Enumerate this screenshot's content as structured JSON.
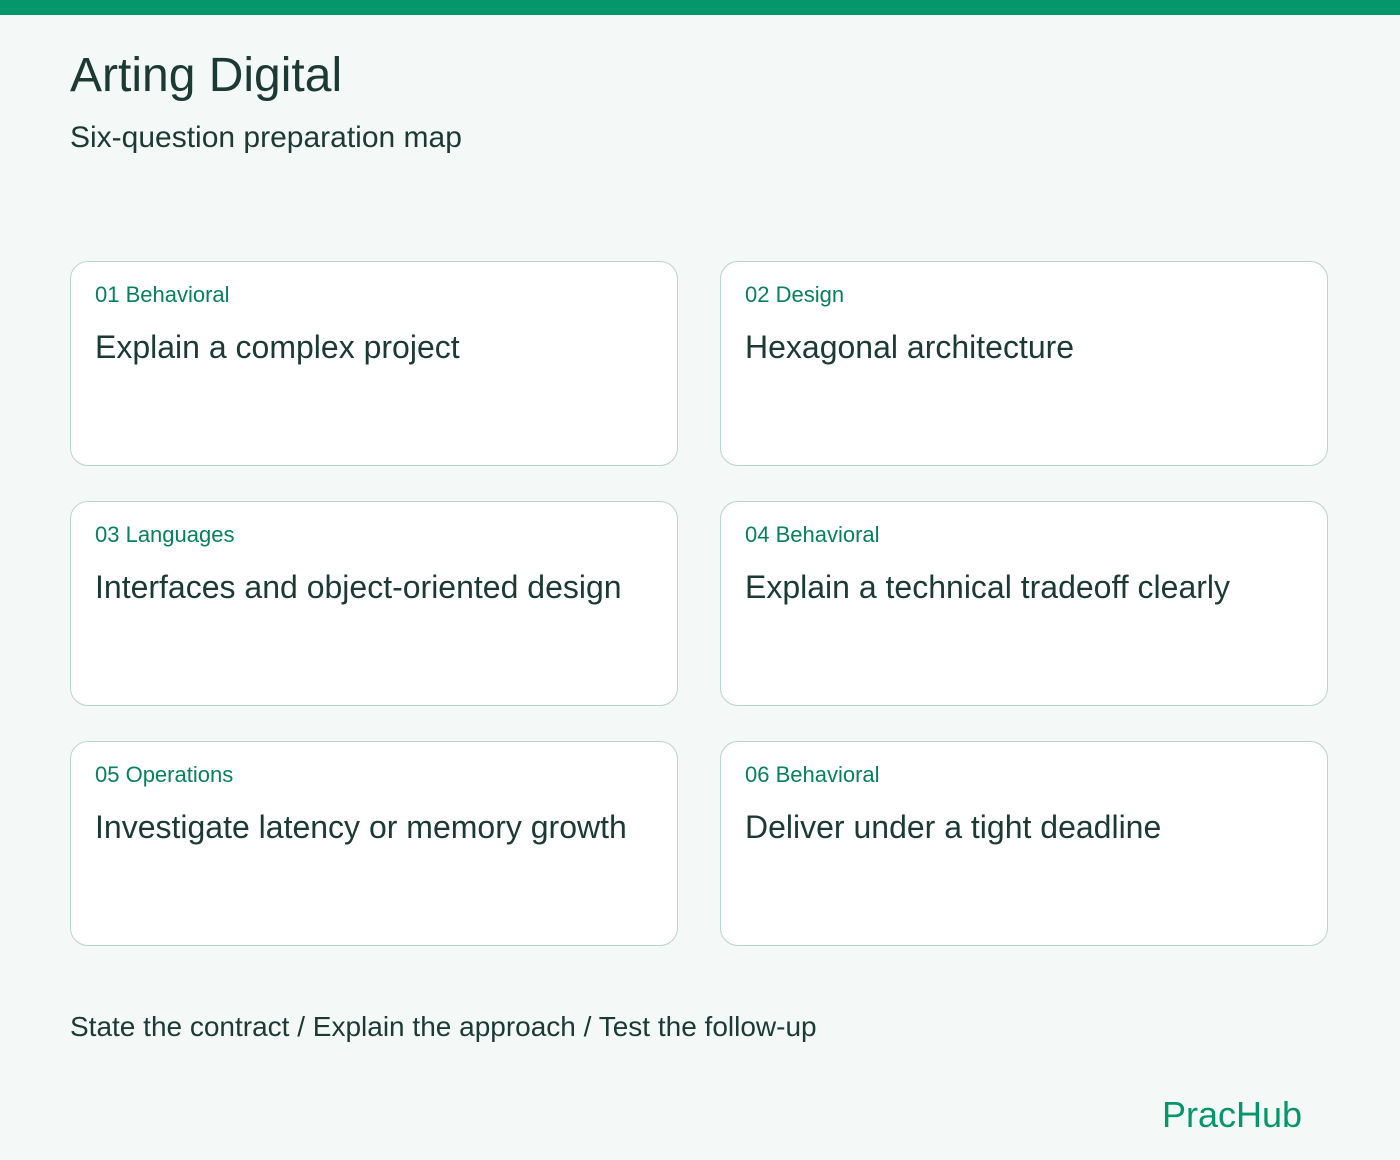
{
  "header": {
    "title": "Arting Digital",
    "subtitle": "Six-question preparation map"
  },
  "cards": [
    {
      "tag": "01 Behavioral",
      "title": "Explain a complex project"
    },
    {
      "tag": "02 Design",
      "title": "Hexagonal architecture"
    },
    {
      "tag": "03 Languages",
      "title": "Interfaces and object-oriented design"
    },
    {
      "tag": "04 Behavioral",
      "title": "Explain a technical tradeoff clearly"
    },
    {
      "tag": "05 Operations",
      "title": "Investigate latency or memory growth"
    },
    {
      "tag": "06 Behavioral",
      "title": "Deliver under a tight deadline"
    }
  ],
  "footer": {
    "note": "State the contract / Explain the approach / Test the follow-up",
    "brand": "PracHub"
  },
  "colors": {
    "accent": "#05966b",
    "tag_text": "#07805d",
    "body_text": "#1b3a33",
    "background": "#f4f8f6",
    "card_border": "#b7d6cb"
  }
}
